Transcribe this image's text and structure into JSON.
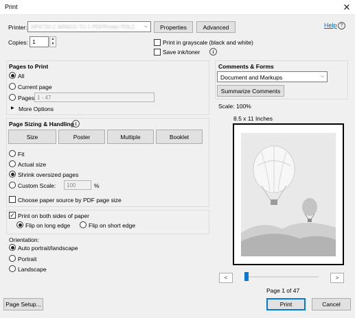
{
  "window": {
    "title": "Print",
    "close_glyph": "✕"
  },
  "printer": {
    "label": "Printer:",
    "value": "HP4720 C MINICU TU 1 PDFPrinter PDL2",
    "properties_label": "Properties",
    "advanced_label": "Advanced",
    "help_label": "Help",
    "help_glyph": "?"
  },
  "copies": {
    "label": "Copies:",
    "value": "1"
  },
  "options": {
    "grayscale_label": "Print in grayscale (black and white)",
    "save_ink_label": "Save ink/toner",
    "info_glyph": "i"
  },
  "pages_to_print": {
    "title": "Pages to Print",
    "all_label": "All",
    "current_label": "Current page",
    "pages_label": "Pages",
    "pages_value": "1 - 47",
    "more_options_label": "More Options",
    "selected": "All"
  },
  "page_sizing": {
    "title": "Page Sizing & Handling",
    "tabs": [
      {
        "label": "Size"
      },
      {
        "label": "Poster"
      },
      {
        "label": "Multiple"
      },
      {
        "label": "Booklet"
      }
    ],
    "fit_label": "Fit",
    "actual_label": "Actual size",
    "shrink_label": "Shrink oversized pages",
    "custom_label": "Custom Scale:",
    "custom_value": "100",
    "percent": "%",
    "paper_source_label": "Choose paper source by PDF page size",
    "selected": "Shrink oversized pages"
  },
  "duplex": {
    "both_sides_label": "Print on both sides of paper",
    "long_edge_label": "Flip on long edge",
    "short_edge_label": "Flip on short edge",
    "checked": true
  },
  "orientation": {
    "title": "Orientation:",
    "auto_label": "Auto portrait/landscape",
    "portrait_label": "Portrait",
    "landscape_label": "Landscape",
    "selected": "Auto portrait/landscape"
  },
  "comments": {
    "title": "Comments & Forms",
    "value": "Document and Markups",
    "summarize_label": "Summarize Comments"
  },
  "preview": {
    "scale_label": "Scale: 100%",
    "paper_label": "8.5 x 11 Inches",
    "page_indicator": "Page 1 of 47",
    "prev_glyph": "<",
    "next_glyph": ">",
    "slider_position": 0.0
  },
  "footer": {
    "page_setup_label": "Page Setup...",
    "print_label": "Print",
    "cancel_label": "Cancel"
  },
  "colors": {
    "link": "#0066cc",
    "accent": "#0078d7"
  }
}
